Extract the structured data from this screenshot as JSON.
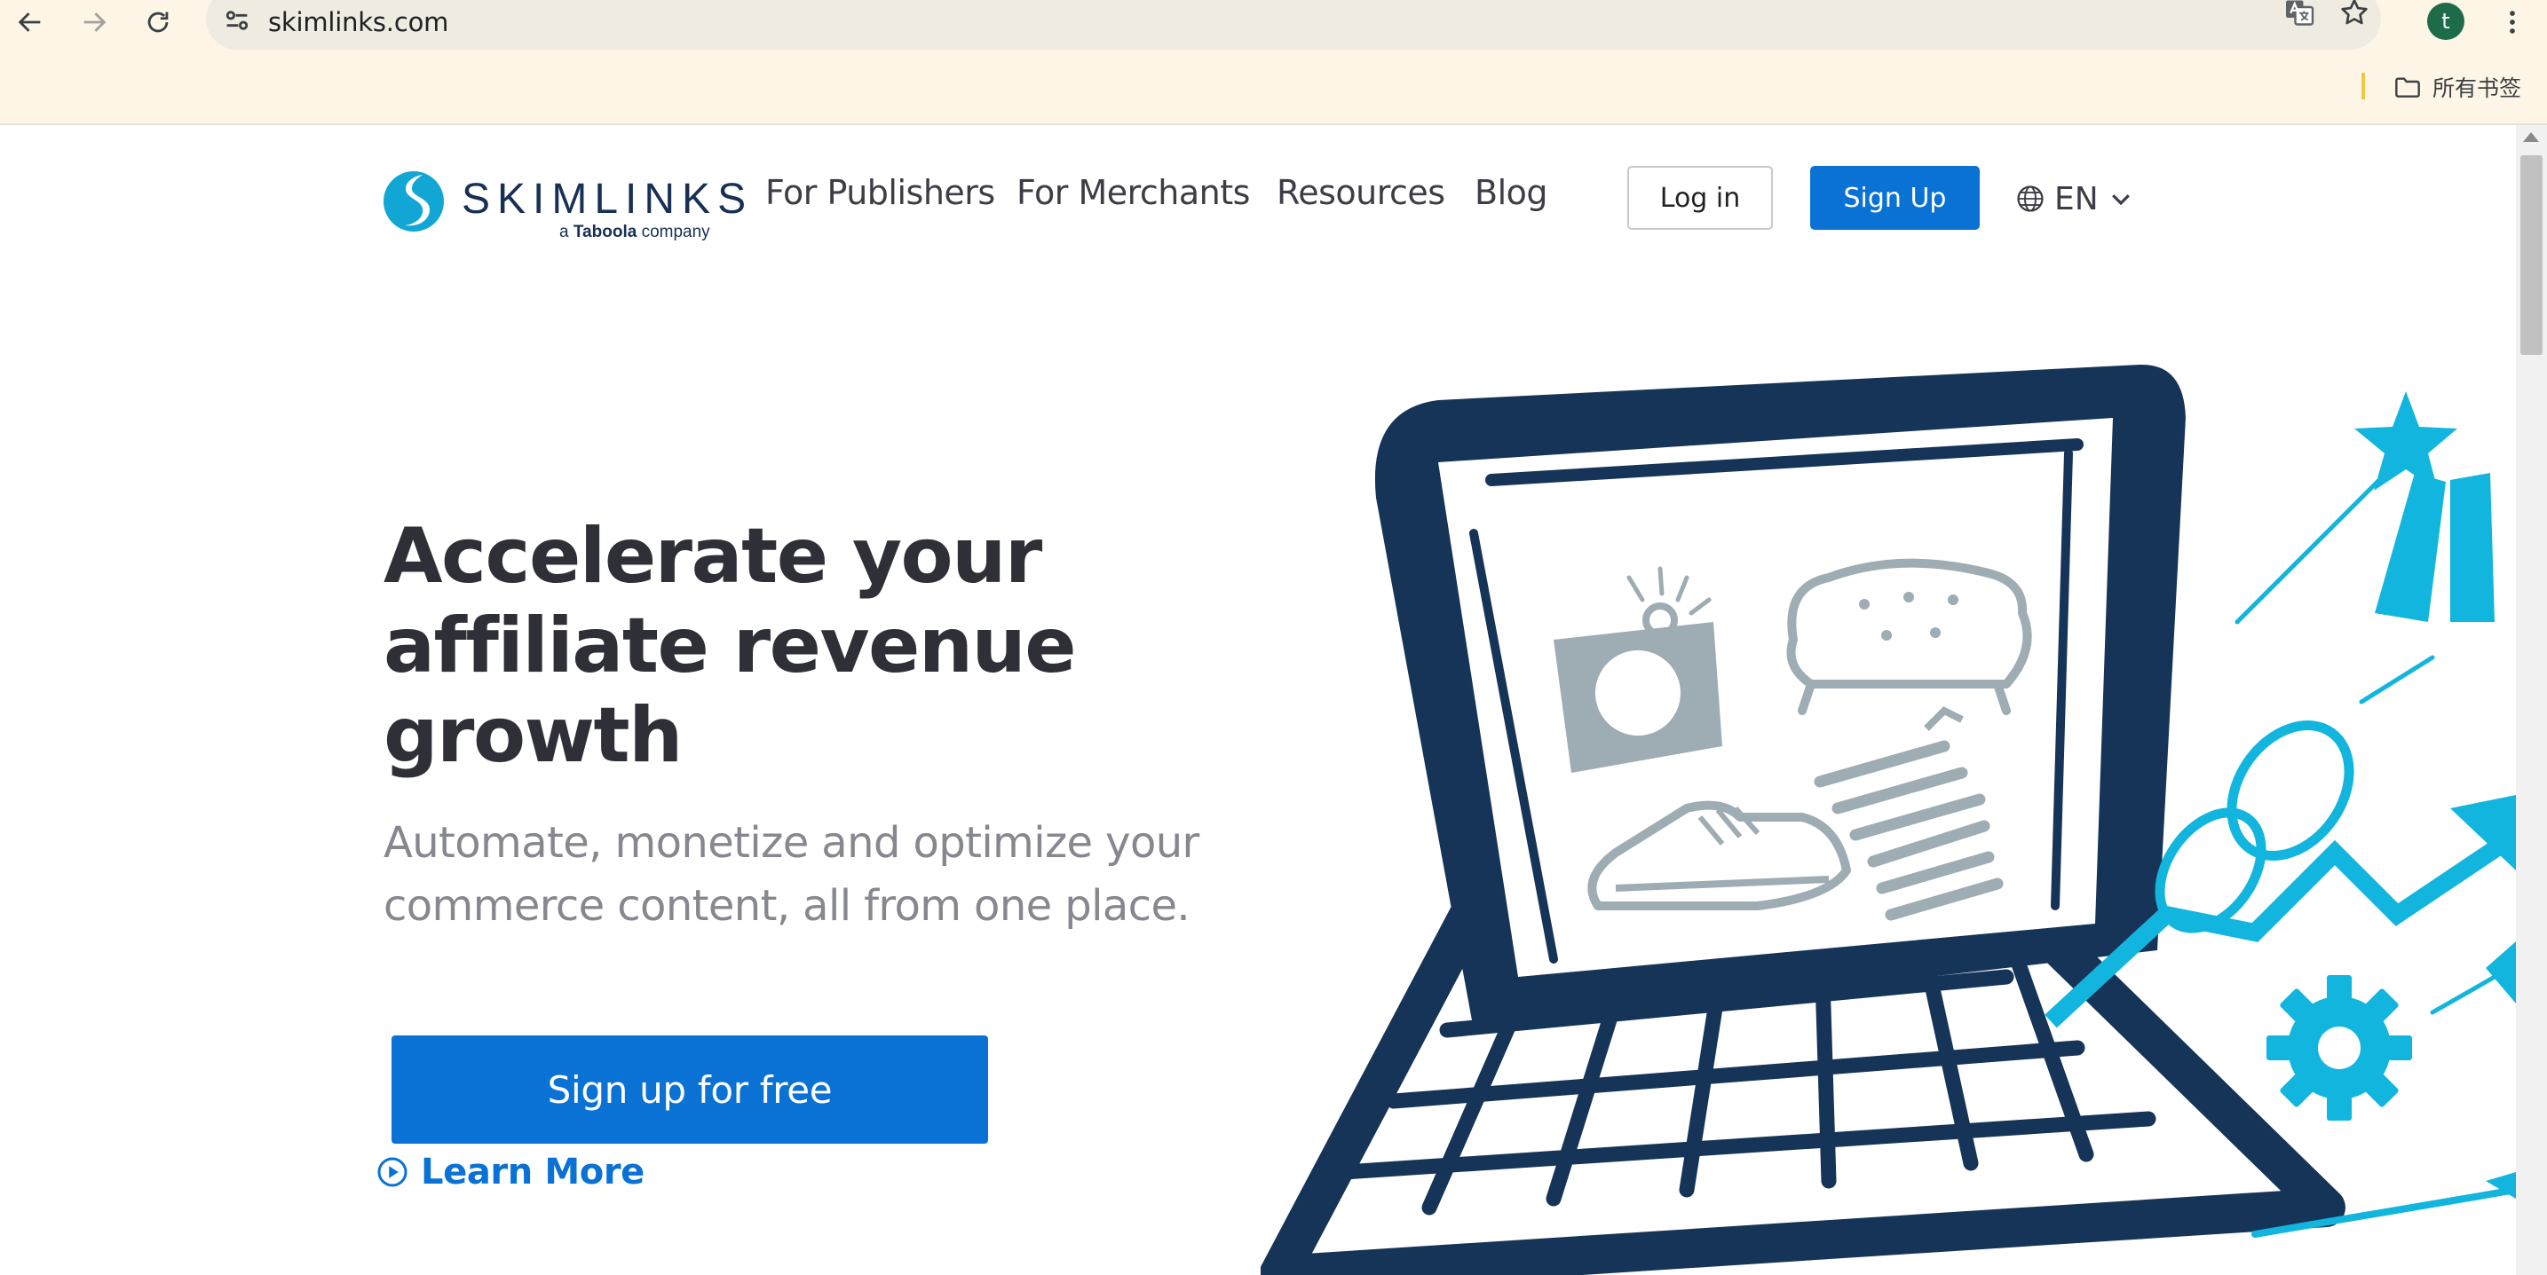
{
  "browser": {
    "url": "skimlinks.com",
    "profile_initial": "t",
    "bookmarks_all_label": "所有书签"
  },
  "site": {
    "logo_text": "SKIMLINKS",
    "logo_tagline_prefix": "a",
    "logo_tagline_brand": "Taboola",
    "logo_tagline_suffix": "company",
    "nav": [
      {
        "label": "For Publishers"
      },
      {
        "label": "For Merchants"
      },
      {
        "label": "Resources"
      },
      {
        "label": "Blog"
      }
    ],
    "login_label": "Log in",
    "signup_label": "Sign Up",
    "language": "EN"
  },
  "hero": {
    "title_lines": [
      "Accelerate your",
      "affiliate revenue",
      "growth"
    ],
    "subtitle_lines": [
      "Automate, monetize and optimize your",
      "commerce content, all from one place."
    ],
    "cta_label": "Sign up for free",
    "learn_more_label": "Learn More"
  },
  "colors": {
    "brand_blue": "#0a72d4",
    "navy": "#183055",
    "accent_cyan": "#12b5de",
    "product_gray": "#9eacb3"
  }
}
